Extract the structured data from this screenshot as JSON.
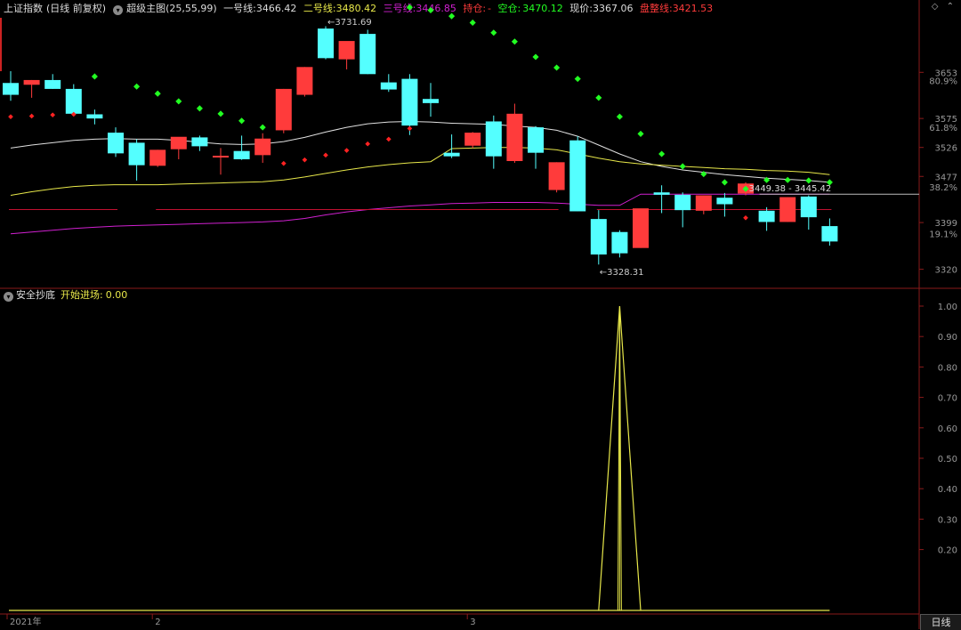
{
  "header": {
    "index_name": "上证指数",
    "period": "(日线 前复权)",
    "indicator": "超级主图(25,55,99)",
    "line1_label": "一号线:",
    "line1_value": "3466.42",
    "line2_label": "二号线:",
    "line2_value": "3480.42",
    "line3_label": "三号线:",
    "line3_value": "3446.85",
    "hold_label": "持仓:",
    "hold_value": "-",
    "empty_label": "空仓:",
    "empty_value": "3470.12",
    "price_label": "现价:",
    "price_value": "3367.06",
    "stop_label": "盘整线:",
    "stop_value": "3421.53"
  },
  "colors": {
    "up": "#ff3b3b",
    "down": "#54ffff",
    "line1": "#e0e0e0",
    "line2": "#e8e84a",
    "line3": "#d020d0",
    "dot_green": "#22ff22",
    "dot_red": "#ff2222",
    "axis": "#8a1a1a"
  },
  "sub_header": {
    "name": "安全抄底",
    "signal_label": "开始进场:",
    "signal_value": "0.00"
  },
  "annotations": {
    "high": "3731.69",
    "low": "3328.31",
    "range": "3449.38 - 3445.42"
  },
  "price_axis": {
    "ticks": [
      {
        "v": 3653,
        "label": "3653"
      },
      {
        "v": 3575,
        "label": "3575"
      },
      {
        "v": 3526,
        "label": "3526"
      },
      {
        "v": 3477,
        "label": "3477"
      },
      {
        "v": 3399,
        "label": "3399"
      },
      {
        "v": 3320,
        "label": "3320"
      }
    ],
    "pcts": [
      {
        "v": 3639,
        "label": "80.9%"
      },
      {
        "v": 3560,
        "label": "61.8%"
      },
      {
        "v": 3459,
        "label": "38.2%"
      },
      {
        "v": 3380,
        "label": "19.1%"
      }
    ]
  },
  "sub_axis": [
    "1.00",
    "0.90",
    "0.80",
    "0.70",
    "0.60",
    "0.50",
    "0.40",
    "0.30",
    "0.20"
  ],
  "time_axis": [
    {
      "label": "2021年",
      "i": 0
    },
    {
      "label": "2",
      "i": 7
    },
    {
      "label": "3",
      "i": 22
    }
  ],
  "period_tab": "日线",
  "chart_data": {
    "type": "candlestick",
    "candles": [
      {
        "o": 3635,
        "h": 3655,
        "l": 3605,
        "c": 3615
      },
      {
        "o": 3632,
        "h": 3640,
        "l": 3610,
        "c": 3640
      },
      {
        "o": 3640,
        "h": 3650,
        "l": 3625,
        "c": 3625
      },
      {
        "o": 3625,
        "h": 3633,
        "l": 3583,
        "c": 3583
      },
      {
        "o": 3582,
        "h": 3590,
        "l": 3565,
        "c": 3575
      },
      {
        "o": 3551,
        "h": 3560,
        "l": 3510,
        "c": 3516
      },
      {
        "o": 3534,
        "h": 3540,
        "l": 3470,
        "c": 3496
      },
      {
        "o": 3495,
        "h": 3522,
        "l": 3493,
        "c": 3522
      },
      {
        "o": 3523,
        "h": 3533,
        "l": 3506,
        "c": 3544
      },
      {
        "o": 3543,
        "h": 3546,
        "l": 3520,
        "c": 3528
      },
      {
        "o": 3512,
        "h": 3525,
        "l": 3480,
        "c": 3512
      },
      {
        "o": 3520,
        "h": 3546,
        "l": 3505,
        "c": 3506
      },
      {
        "o": 3513,
        "h": 3550,
        "l": 3500,
        "c": 3541
      },
      {
        "o": 3555,
        "h": 3625,
        "l": 3550,
        "c": 3625
      },
      {
        "o": 3615,
        "h": 3662,
        "l": 3612,
        "c": 3662
      },
      {
        "o": 3727,
        "h": 3731,
        "l": 3675,
        "c": 3677
      },
      {
        "o": 3675,
        "h": 3700,
        "l": 3658,
        "c": 3706
      },
      {
        "o": 3718,
        "h": 3725,
        "l": 3650,
        "c": 3650
      },
      {
        "o": 3636,
        "h": 3650,
        "l": 3620,
        "c": 3624
      },
      {
        "o": 3642,
        "h": 3650,
        "l": 3547,
        "c": 3563
      },
      {
        "o": 3608,
        "h": 3635,
        "l": 3578,
        "c": 3601
      },
      {
        "o": 3517,
        "h": 3548,
        "l": 3508,
        "c": 3511
      },
      {
        "o": 3529,
        "h": 3552,
        "l": 3525,
        "c": 3551
      },
      {
        "o": 3570,
        "h": 3580,
        "l": 3490,
        "c": 3511
      },
      {
        "o": 3503,
        "h": 3600,
        "l": 3500,
        "c": 3583
      },
      {
        "o": 3560,
        "h": 3562,
        "l": 3490,
        "c": 3517
      },
      {
        "o": 3454,
        "h": 3501,
        "l": 3450,
        "c": 3501
      },
      {
        "o": 3538,
        "h": 3545,
        "l": 3418,
        "c": 3418
      },
      {
        "o": 3405,
        "h": 3420,
        "l": 3328,
        "c": 3345
      },
      {
        "o": 3383,
        "h": 3386,
        "l": 3340,
        "c": 3347
      },
      {
        "o": 3356,
        "h": 3420,
        "l": 3356,
        "c": 3423
      },
      {
        "o": 3450,
        "h": 3462,
        "l": 3415,
        "c": 3446
      },
      {
        "o": 3446,
        "h": 3450,
        "l": 3391,
        "c": 3420
      },
      {
        "o": 3419,
        "h": 3445,
        "l": 3413,
        "c": 3445
      },
      {
        "o": 3441,
        "h": 3449,
        "l": 3409,
        "c": 3430
      },
      {
        "o": 3448,
        "h": 3467,
        "l": 3445,
        "c": 3465
      },
      {
        "o": 3419,
        "h": 3425,
        "l": 3385,
        "c": 3400
      },
      {
        "o": 3400,
        "h": 3442,
        "l": 3400,
        "c": 3442
      },
      {
        "o": 3443,
        "h": 3445,
        "l": 3387,
        "c": 3408
      },
      {
        "o": 3393,
        "h": 3406,
        "l": 3360,
        "c": 3367
      }
    ],
    "line1": [
      3525,
      3530,
      3534,
      3538,
      3540,
      3541,
      3540,
      3540,
      3538,
      3535,
      3532,
      3531,
      3532,
      3536,
      3543,
      3552,
      3560,
      3566,
      3569,
      3570,
      3569,
      3567,
      3566,
      3565,
      3562,
      3560,
      3555,
      3545,
      3530,
      3515,
      3502,
      3494,
      3488,
      3484,
      3480,
      3477,
      3474,
      3472,
      3470,
      3467
    ],
    "line2": [
      3445,
      3451,
      3456,
      3460,
      3462,
      3463,
      3463,
      3463,
      3464,
      3465,
      3466,
      3467,
      3468,
      3471,
      3476,
      3482,
      3488,
      3493,
      3497,
      3500,
      3502,
      3524,
      3525,
      3526,
      3526,
      3525,
      3522,
      3515,
      3508,
      3502,
      3498,
      3496,
      3494,
      3492,
      3490,
      3489,
      3487,
      3486,
      3484,
      3480
    ],
    "line3": [
      3380,
      3383,
      3386,
      3389,
      3391,
      3393,
      3394,
      3395,
      3396,
      3397,
      3398,
      3399,
      3400,
      3402,
      3406,
      3412,
      3417,
      3421,
      3424,
      3427,
      3429,
      3431,
      3432,
      3433,
      3433,
      3433,
      3432,
      3430,
      3428,
      3428,
      3447,
      3447,
      3447,
      3447,
      3447,
      3447,
      3447,
      3447,
      3447,
      3447
    ],
    "stop_segments": [
      {
        "from": 0,
        "to": 5,
        "v": 3421
      },
      {
        "from": 7,
        "to": 26,
        "v": 3421
      },
      {
        "from": 28,
        "to": 39,
        "v": 3421
      }
    ],
    "green_dots": [
      {
        "i": 4,
        "v": 3646
      },
      {
        "i": 6,
        "v": 3629
      },
      {
        "i": 7,
        "v": 3617
      },
      {
        "i": 8,
        "v": 3604
      },
      {
        "i": 9,
        "v": 3592
      },
      {
        "i": 10,
        "v": 3583
      },
      {
        "i": 11,
        "v": 3571
      },
      {
        "i": 12,
        "v": 3560
      },
      {
        "i": 19,
        "v": 3763
      },
      {
        "i": 20,
        "v": 3758
      },
      {
        "i": 21,
        "v": 3748
      },
      {
        "i": 22,
        "v": 3737
      },
      {
        "i": 23,
        "v": 3720
      },
      {
        "i": 24,
        "v": 3705
      },
      {
        "i": 25,
        "v": 3679
      },
      {
        "i": 26,
        "v": 3661
      },
      {
        "i": 27,
        "v": 3642
      },
      {
        "i": 28,
        "v": 3610
      },
      {
        "i": 29,
        "v": 3578
      },
      {
        "i": 30,
        "v": 3549
      },
      {
        "i": 31,
        "v": 3515
      },
      {
        "i": 32,
        "v": 3494
      },
      {
        "i": 33,
        "v": 3481
      },
      {
        "i": 34,
        "v": 3467
      },
      {
        "i": 35,
        "v": 3456
      },
      {
        "i": 36,
        "v": 3471
      },
      {
        "i": 37,
        "v": 3471
      },
      {
        "i": 38,
        "v": 3470
      },
      {
        "i": 39,
        "v": 3467
      }
    ],
    "red_dots": [
      {
        "i": 0,
        "v": 3578
      },
      {
        "i": 1,
        "v": 3579
      },
      {
        "i": 2,
        "v": 3581
      },
      {
        "i": 3,
        "v": 3582
      },
      {
        "i": 13,
        "v": 3499
      },
      {
        "i": 14,
        "v": 3505
      },
      {
        "i": 15,
        "v": 3513
      },
      {
        "i": 16,
        "v": 3521
      },
      {
        "i": 17,
        "v": 3532
      },
      {
        "i": 18,
        "v": 3540
      },
      {
        "i": 19,
        "v": 3558
      },
      {
        "i": 35,
        "v": 3407
      }
    ],
    "signal": {
      "zero_from": 0,
      "zero_to": 39,
      "peaks": [
        {
          "i": 29,
          "v": 1.0
        }
      ]
    }
  }
}
